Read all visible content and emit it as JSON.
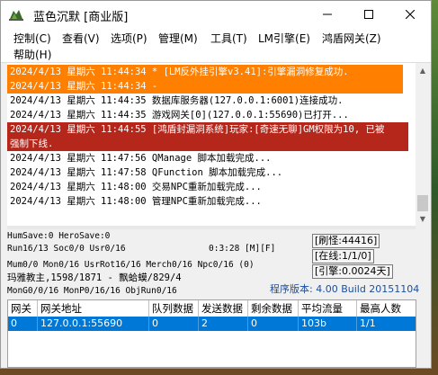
{
  "window": {
    "title": "蓝色沉默 [商业版]",
    "controls": {
      "minimize": "minimize-icon",
      "maximize": "maximize-icon",
      "close": "close-icon"
    }
  },
  "menu": {
    "row1": [
      "控制(C)",
      "查看(V)",
      "选项(P)",
      "管理(M)",
      "工具(T)",
      "LM引擎(E)",
      "鸿盾网关(Z)"
    ],
    "row2": [
      "帮助(H)"
    ]
  },
  "log": {
    "lines": [
      {
        "text": "2024/4/13 星期六 11:44:34 * [LM反外挂引擎v3.41]:引擎漏洞修复成功.",
        "style": "orange"
      },
      {
        "text": "2024/4/13 星期六 11:44:34 -",
        "style": "orange"
      },
      {
        "text": "2024/4/13 星期六 11:44:35 数据库服务器(127.0.0.1:6001)连接成功.",
        "style": "normal"
      },
      {
        "text": "2024/4/13 星期六 11:44:35 游戏网关[0](127.0.0.1:55690)已打开...",
        "style": "normal"
      },
      {
        "text": "2024/4/13 星期六 11:44:55 [鸿盾封漏洞系统]玩家:[奇速无聊]GM权限为10, 已被",
        "style": "red"
      },
      {
        "text": "强制下线.",
        "style": "red"
      },
      {
        "text": "2024/4/13 星期六 11:47:56 QManage 脚本加载完成...",
        "style": "normal"
      },
      {
        "text": "2024/4/13 星期六 11:47:58 QFunction 脚本加载完成...",
        "style": "normal"
      },
      {
        "text": "2024/4/13 星期六 11:48:00 交易NPC重新加载完成...",
        "style": "normal"
      },
      {
        "text": "2024/4/13 星期六 11:48:00 管理NPC重新加载完成...",
        "style": "normal"
      }
    ]
  },
  "status": {
    "line1": "HumSave:0 HeroSave:0",
    "line2_left": "Run16/13 Soc0/0 Usr0/16",
    "line2_mid": "0:3:28 [M][F]",
    "line3": "Mum0/0 Mon0/16 UsrRot16/16 Merch0/16 Npc0/16 (0)",
    "line4": "玛雅教主,1598/1871 - 飘蛤蟆/829/4",
    "line5": "MonG0/0/16 MonP0/16/16 ObjRun0/16",
    "refresh": "[刷怪:44416]",
    "online": "[在线:1/1/0]",
    "engine": "[引擎:0.0024天]",
    "version": "程序版本: 4.00 Build 20151104"
  },
  "table": {
    "headers": [
      "网关",
      "网关地址",
      "队列数据",
      "发送数据",
      "剩余数据",
      "平均流量",
      "最高人数"
    ],
    "rows": [
      [
        "0",
        "127.0.0.1:55690",
        "0",
        "2",
        "0",
        "103b",
        "1/1"
      ]
    ]
  },
  "colors": {
    "log_orange": "#ff7f00",
    "log_red": "#b5261b",
    "selection": "#0078d7",
    "version_text": "#1a4fa0"
  }
}
